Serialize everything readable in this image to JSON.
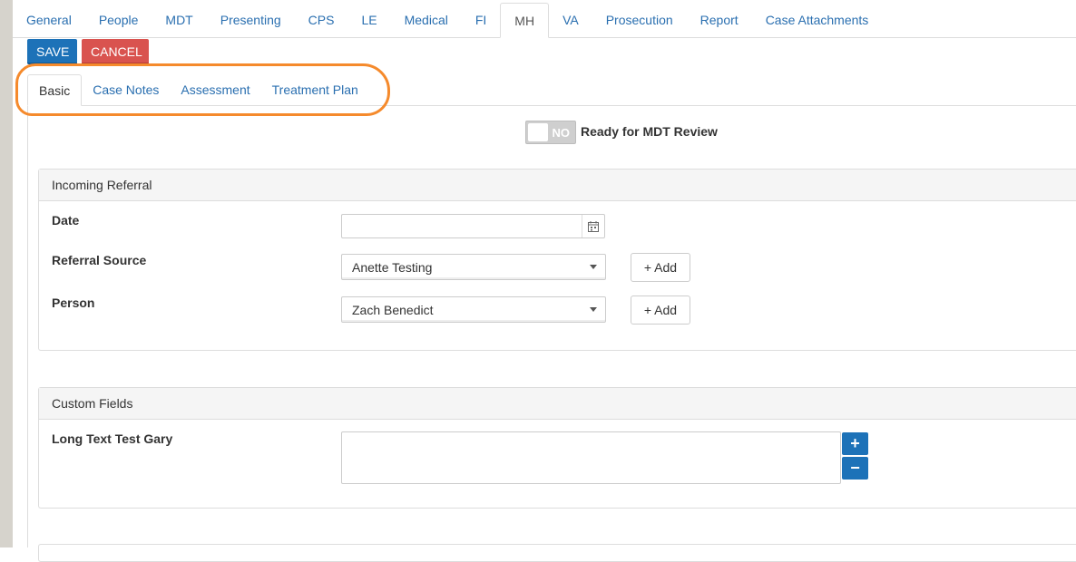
{
  "top_tabs": [
    "General",
    "People",
    "MDT",
    "Presenting",
    "CPS",
    "LE",
    "Medical",
    "FI",
    "MH",
    "VA",
    "Prosecution",
    "Report",
    "Case Attachments"
  ],
  "active_top_tab": "MH",
  "actions": {
    "save_label": "SAVE",
    "cancel_label": "CANCEL"
  },
  "sub_tabs": [
    "Basic",
    "Case Notes",
    "Assessment",
    "Treatment Plan"
  ],
  "active_sub_tab": "Basic",
  "toggle": {
    "state_text": "NO",
    "label": "Ready for MDT Review"
  },
  "incoming_referral": {
    "heading": "Incoming Referral",
    "date_label": "Date",
    "date_value": "",
    "referral_source_label": "Referral Source",
    "referral_source_value": "Anette Testing",
    "person_label": "Person",
    "person_value": "Zach Benedict",
    "add_label": "+ Add"
  },
  "custom_fields": {
    "heading": "Custom Fields",
    "long_text_label": "Long Text Test Gary",
    "plus": "+",
    "minus": "−"
  },
  "colors": {
    "primary": "#1d72b8",
    "danger": "#d9534f",
    "link": "#2a6fb0",
    "highlight": "#f58a2c"
  }
}
